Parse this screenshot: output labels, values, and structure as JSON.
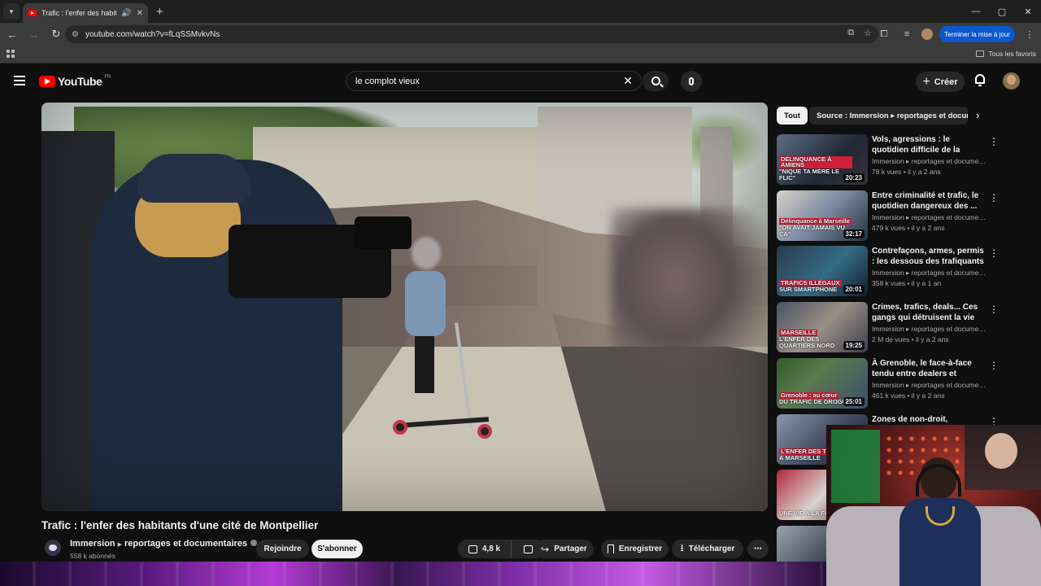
{
  "browser": {
    "tab_title": "Trafic : l'enfer des habitants",
    "url": "youtube.com/watch?v=fLqSSMvkvNs",
    "update_label": "Terminer la mise à jour",
    "bookmarks_label": "Tous les favoris"
  },
  "header": {
    "logo_text": "YouTube",
    "country": "FR",
    "search_value": "le complot vieux",
    "create_label": "Créer"
  },
  "video": {
    "title": "Trafic : l'enfer des habitants d'une cité de Montpellier",
    "channel": "Immersion",
    "channel_suffix": "reportages et documentaires",
    "subscribers": "558 k abonnés",
    "join_label": "Rejoindre",
    "subscribe_label": "S'abonner",
    "likes": "4,8 k",
    "share_label": "Partager",
    "save_label": "Enregistrer",
    "download_label": "Télécharger"
  },
  "chips": {
    "all": "Tout",
    "source": "Source : Immersion ▸ reportages et documentaires"
  },
  "recommendations": [
    {
      "title": "Vols, agressions : le quotidien difficile de la brigade nocturne...",
      "channel": "Immersion ▸ reportages et documentair...",
      "meta": "78 k vues • il y a 2 ans",
      "duration": "20:23",
      "caption_tag": "DÉLINQUANCE À AMIENS",
      "caption": "\"NIQUE TA MÈRE LE FLIC\""
    },
    {
      "title": "Entre criminalité et trafic, le quotidien dangereux des ...",
      "channel": "Immersion ▸ reportages et documentair...",
      "meta": "479 k vues • il y a 2 ans",
      "duration": "32:17",
      "caption_tag": "Délinquance à Marseille",
      "caption": "\"ON AVAIT JAMAIS VU ÇA\""
    },
    {
      "title": "Contrefaçons, armes, permis : les dessous des trafiquants",
      "channel": "Immersion ▸ reportages et documentair...",
      "meta": "358 k vues • il y a 1 an",
      "duration": "20:01",
      "caption_tag": "TRAFICS ILLÉGAUX",
      "caption": "SUR SMARTPHONE"
    },
    {
      "title": "Crimes, trafics, deals... Ces gangs qui détruisent la vie des...",
      "channel": "Immersion ▸ reportages et documentair...",
      "meta": "2 M de vues • il y a 2 ans",
      "duration": "19:25",
      "caption_tag": "MARSEILLE",
      "caption": "L'ENFER DES QUARTIERS NORD"
    },
    {
      "title": "À Grenoble, le face-à-face tendu entre dealers et policiers",
      "channel": "Immersion ▸ reportages et documentair...",
      "meta": "461 k vues • il y a 2 ans",
      "duration": "25:01",
      "caption_tag": "Grenoble : au cœur",
      "caption": "DU TRAFIC DE DROGUE"
    },
    {
      "title": "Zones de non-droit, fusillades,",
      "channel": "",
      "meta": "",
      "duration": "",
      "caption_tag": "L'ENFER DES T",
      "caption": "À MARSEILLE"
    },
    {
      "title": "",
      "channel": "",
      "meta": "",
      "duration": "",
      "caption_tag": "",
      "caption": "UNE VIE À LA FO"
    },
    {
      "title": "",
      "channel": "",
      "meta": "",
      "duration": "",
      "caption_tag": "",
      "caption": ""
    }
  ]
}
